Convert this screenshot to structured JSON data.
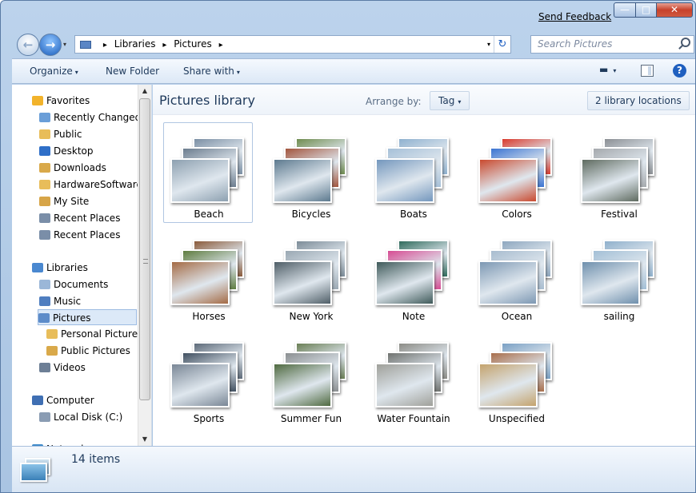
{
  "titlebar": {
    "feedback_label": "Send Feedback",
    "minimize_glyph": "—",
    "maximize_glyph": "□",
    "close_glyph": "✕"
  },
  "address": {
    "crumbs": [
      "Libraries",
      "Pictures"
    ],
    "separator": "▸",
    "dropdown_glyph": "▾",
    "refresh_glyph": "↻"
  },
  "search": {
    "placeholder": "Search Pictures"
  },
  "toolbar": {
    "organize_label": "Organize",
    "new_folder_label": "New Folder",
    "share_label": "Share with",
    "caret": "▾",
    "help_glyph": "?"
  },
  "nav": {
    "items": [
      {
        "label": "Favorites",
        "icon": "star-icon",
        "color": "#f2b32b"
      },
      {
        "label": "Recently Changed",
        "icon": "recent-icon",
        "color": "#6a9ed8"
      },
      {
        "label": "Public",
        "icon": "folder-icon",
        "color": "#e8bd5a"
      },
      {
        "label": "Desktop",
        "icon": "desktop-icon",
        "color": "#2f6fc8"
      },
      {
        "label": "Downloads",
        "icon": "downloads-icon",
        "color": "#d9a94a"
      },
      {
        "label": "HardwareSoftware",
        "icon": "folder-icon",
        "color": "#e8bd5a"
      },
      {
        "label": "My Site",
        "icon": "site-icon",
        "color": "#d7a548"
      },
      {
        "label": "Recent Places",
        "icon": "recent-places-icon",
        "color": "#7a8ea8"
      },
      {
        "label": "Recent Places",
        "icon": "recent-places-icon",
        "color": "#7a8ea8"
      },
      {
        "label": "Libraries",
        "icon": "libraries-icon",
        "color": "#4a88d0"
      },
      {
        "label": "Documents",
        "icon": "documents-icon",
        "color": "#9bb7d8"
      },
      {
        "label": "Music",
        "icon": "music-icon",
        "color": "#4f7ec0"
      },
      {
        "label": "Pictures",
        "icon": "pictures-icon",
        "color": "#5d8cc9"
      },
      {
        "label": "Personal Pictures",
        "icon": "folder-icon",
        "color": "#e8bd5a"
      },
      {
        "label": "Public Pictures",
        "icon": "folder-icon",
        "color": "#d9a94a"
      },
      {
        "label": "Videos",
        "icon": "videos-icon",
        "color": "#6d7f96"
      },
      {
        "label": "Computer",
        "icon": "computer-icon",
        "color": "#3f6fb3"
      },
      {
        "label": "Local Disk (C:)",
        "icon": "disk-icon",
        "color": "#8a9cb3"
      },
      {
        "label": "Network",
        "icon": "network-icon",
        "color": "#3f8ac9"
      }
    ]
  },
  "library": {
    "title": "Pictures library",
    "arrange_label": "Arrange by:",
    "arrange_value": "Tag",
    "locations_label": "2 library locations"
  },
  "tiles": [
    {
      "label": "Beach",
      "colors": [
        "#7b8fa4",
        "#6b7c8e",
        "#8da0b0"
      ]
    },
    {
      "label": "Bicycles",
      "colors": [
        "#6f8c4f",
        "#a2553d",
        "#5d7a8f"
      ]
    },
    {
      "label": "Boats",
      "colors": [
        "#8fb1cf",
        "#a6c0d8",
        "#7497bd"
      ]
    },
    {
      "label": "Colors",
      "colors": [
        "#d93a2d",
        "#3b74d2",
        "#c94a2f"
      ]
    },
    {
      "label": "Festival",
      "colors": [
        "#8b8f94",
        "#a5a9ad",
        "#5f6b60"
      ]
    },
    {
      "label": "Horses",
      "colors": [
        "#8a5a3a",
        "#5e7c3f",
        "#a46b45"
      ]
    },
    {
      "label": "New York",
      "colors": [
        "#7c8c98",
        "#9aa8b3",
        "#4f5e67"
      ]
    },
    {
      "label": "Note",
      "colors": [
        "#2f6b5c",
        "#d64c93",
        "#3f5a5a"
      ]
    },
    {
      "label": "Ocean",
      "colors": [
        "#8ea7bf",
        "#a8bccf",
        "#7d98b3"
      ]
    },
    {
      "label": "sailing",
      "colors": [
        "#8fb0cc",
        "#a3bfd6",
        "#6f90ad"
      ]
    },
    {
      "label": "Sports",
      "colors": [
        "#5d6a79",
        "#3f4e5f",
        "#7a8796"
      ]
    },
    {
      "label": "Summer Fun",
      "colors": [
        "#6a7f55",
        "#8b8f91",
        "#4f6a40"
      ]
    },
    {
      "label": "Water Fountain",
      "colors": [
        "#8c8c86",
        "#6f726f",
        "#9fa09a"
      ]
    },
    {
      "label": "Unspecified",
      "colors": [
        "#7aa0c4",
        "#a86e4b",
        "#c4a36d"
      ]
    }
  ],
  "status": {
    "count_label": "14 items"
  },
  "scroll": {
    "up_glyph": "▲",
    "down_glyph": "▼"
  }
}
